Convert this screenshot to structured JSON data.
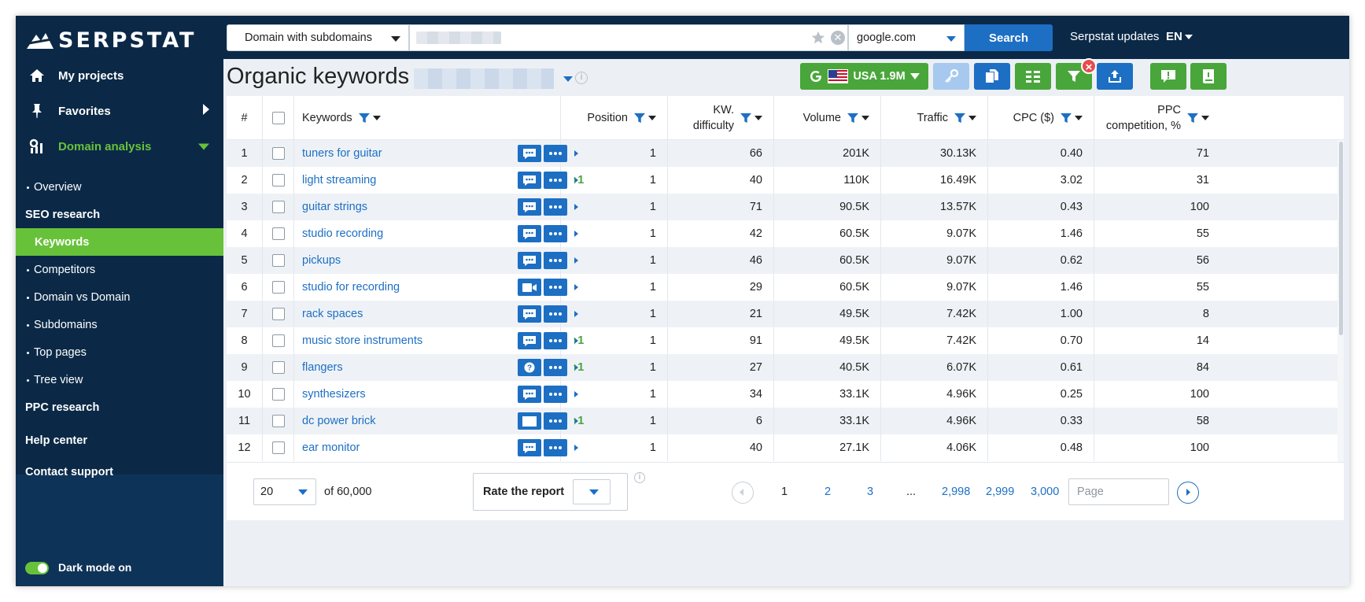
{
  "app": {
    "logo": "SERPSTAT"
  },
  "sidebar": {
    "items": [
      {
        "label": "My projects",
        "icon": "home-icon"
      },
      {
        "label": "Favorites",
        "icon": "pin-icon"
      },
      {
        "label": "Domain analysis",
        "icon": "analysis-icon"
      }
    ],
    "subitems": [
      {
        "label": "Overview",
        "type": "item"
      },
      {
        "label": "SEO research",
        "type": "head"
      },
      {
        "label": "Keywords",
        "type": "active"
      },
      {
        "label": "Competitors",
        "type": "item"
      },
      {
        "label": "Domain vs Domain",
        "type": "item"
      },
      {
        "label": "Subdomains",
        "type": "item"
      },
      {
        "label": "Top pages",
        "type": "item"
      },
      {
        "label": "Tree view",
        "type": "item"
      },
      {
        "label": "PPC research",
        "type": "head"
      }
    ],
    "help_center": "Help center",
    "contact_support": "Contact support",
    "dark_mode": "Dark mode on"
  },
  "topbar": {
    "scope_select": "Domain with subdomains",
    "search_value": "",
    "engine_select": "google.com",
    "search_button": "Search",
    "updates": "Serpstat updates",
    "language": "EN"
  },
  "page": {
    "title": "Organic keywords",
    "region_button": "USA 1.9M"
  },
  "colors": {
    "brand_green": "#49a63a",
    "brand_blue": "#1d6fc4",
    "sidebar_bg": "#0b2947",
    "active_green": "#67c23a"
  },
  "table": {
    "headers": {
      "num": "#",
      "keywords": "Keywords",
      "position": "Position",
      "kd_line1": "KW.",
      "kd_line2": "difficulty",
      "volume": "Volume",
      "traffic": "Traffic",
      "cpc": "CPC ($)",
      "ppc_line1": "PPC",
      "ppc_line2": "competition, %"
    },
    "rows": [
      {
        "n": "1",
        "kw": "tuners for guitar",
        "change": "",
        "pos": "1",
        "kd": "66",
        "vol": "201K",
        "traffic": "30.13K",
        "cpc": "0.40",
        "ppc": "71",
        "icon": "chat"
      },
      {
        "n": "2",
        "kw": "light streaming",
        "change": "1",
        "pos": "1",
        "kd": "40",
        "vol": "110K",
        "traffic": "16.49K",
        "cpc": "3.02",
        "ppc": "31",
        "icon": "chat"
      },
      {
        "n": "3",
        "kw": "guitar strings",
        "change": "",
        "pos": "1",
        "kd": "71",
        "vol": "90.5K",
        "traffic": "13.57K",
        "cpc": "0.43",
        "ppc": "100",
        "icon": "chat"
      },
      {
        "n": "4",
        "kw": "studio recording",
        "change": "",
        "pos": "1",
        "kd": "42",
        "vol": "60.5K",
        "traffic": "9.07K",
        "cpc": "1.46",
        "ppc": "55",
        "icon": "chat"
      },
      {
        "n": "5",
        "kw": "pickups",
        "change": "",
        "pos": "1",
        "kd": "46",
        "vol": "60.5K",
        "traffic": "9.07K",
        "cpc": "0.62",
        "ppc": "56",
        "icon": "chat"
      },
      {
        "n": "6",
        "kw": "studio for recording",
        "change": "",
        "pos": "1",
        "kd": "29",
        "vol": "60.5K",
        "traffic": "9.07K",
        "cpc": "1.46",
        "ppc": "55",
        "icon": "video"
      },
      {
        "n": "7",
        "kw": "rack spaces",
        "change": "",
        "pos": "1",
        "kd": "21",
        "vol": "49.5K",
        "traffic": "7.42K",
        "cpc": "1.00",
        "ppc": "8",
        "icon": "chat"
      },
      {
        "n": "8",
        "kw": "music store instruments",
        "change": "1",
        "pos": "1",
        "kd": "91",
        "vol": "49.5K",
        "traffic": "7.42K",
        "cpc": "0.70",
        "ppc": "14",
        "icon": "chat"
      },
      {
        "n": "9",
        "kw": "flangers",
        "change": "1",
        "pos": "1",
        "kd": "27",
        "vol": "40.5K",
        "traffic": "6.07K",
        "cpc": "0.61",
        "ppc": "84",
        "icon": "question"
      },
      {
        "n": "10",
        "kw": "synthesizers",
        "change": "",
        "pos": "1",
        "kd": "34",
        "vol": "33.1K",
        "traffic": "4.96K",
        "cpc": "0.25",
        "ppc": "100",
        "icon": "chat"
      },
      {
        "n": "11",
        "kw": "dc power brick",
        "change": "1",
        "pos": "1",
        "kd": "6",
        "vol": "33.1K",
        "traffic": "4.96K",
        "cpc": "0.33",
        "ppc": "58",
        "icon": "blank"
      },
      {
        "n": "12",
        "kw": "ear monitor",
        "change": "",
        "pos": "1",
        "kd": "40",
        "vol": "27.1K",
        "traffic": "4.06K",
        "cpc": "0.48",
        "ppc": "100",
        "icon": "chat"
      }
    ]
  },
  "footer": {
    "per_page": "20",
    "of_total": "of 60,000",
    "rate_report": "Rate the report",
    "pages": [
      "1",
      "2",
      "3",
      "...",
      "2,998",
      "2,999",
      "3,000"
    ],
    "page_placeholder": "Page"
  }
}
